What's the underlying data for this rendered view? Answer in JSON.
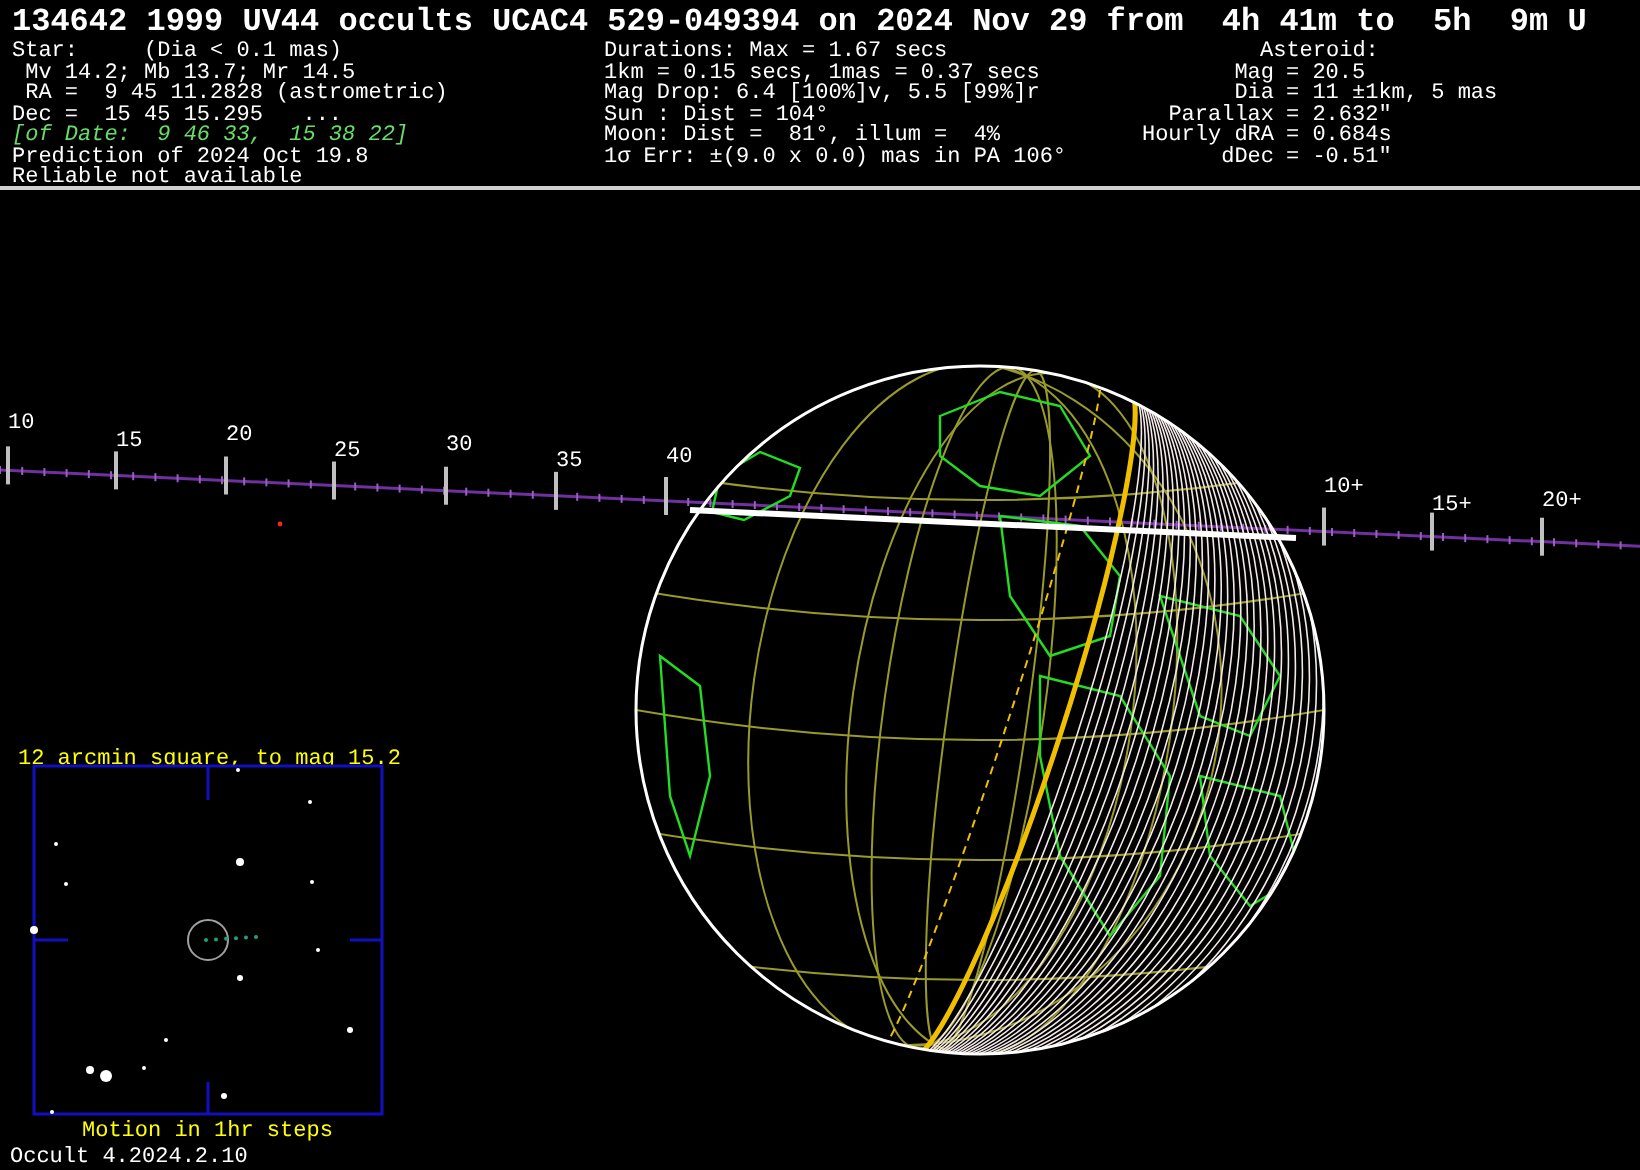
{
  "title": "134642 1999 UV44 occults UCAC4 529-049394 on 2024 Nov 29 from  4h 41m to  5h  9m U",
  "star": {
    "lines": [
      {
        "kind": "plain",
        "text": "Star:     (Dia < 0.1 mas)"
      },
      {
        "kind": "plain",
        "text": " Mv 14.2; Mb 13.7; Mr 14.5"
      },
      {
        "kind": "plain",
        "text": " RA =  9 45 11.2828 (astrometric)"
      },
      {
        "kind": "plain",
        "text": "Dec =  15 45 15.295   ..."
      },
      {
        "kind": "of_date",
        "text": "[of Date:  9 46 33,  15 38 22]"
      },
      {
        "kind": "plain",
        "text": "Prediction of 2024 Oct 19.8"
      },
      {
        "kind": "plain",
        "text": "Reliable not available"
      }
    ]
  },
  "event": {
    "lines": [
      "Durations: Max = 1.67 secs",
      "1km = 0.15 secs, 1mas = 0.37 secs",
      "Mag Drop: 6.4 [100%]v, 5.5 [99%]r",
      "Sun : Dist = 104°",
      "Moon: Dist =  81°, illum =  4%",
      "1σ Err: ±(9.0 x 0.0) mas in PA 106°"
    ]
  },
  "asteroid": {
    "heading": "Asteroid:",
    "rows": [
      {
        "label": "Mag",
        "value": "= 20.5"
      },
      {
        "label": "Dia",
        "value": "= 11 ±1km, 5 mas"
      },
      {
        "label": "Parallax",
        "value": "= 2.632\""
      },
      {
        "label": "Hourly dRA",
        "value": "= 0.684s"
      },
      {
        "label": "dDec",
        "value": "= -0.51\""
      }
    ]
  },
  "time_scale": {
    "labels": [
      "10",
      "15",
      "20",
      "25",
      "30",
      "35",
      "40",
      "10+",
      "15+",
      "20+"
    ]
  },
  "star_chart": {
    "title": "12 arcmin square, to mag 15.2",
    "caption": "Motion in 1hr steps"
  },
  "version": "Occult 4.2024.2.10"
}
